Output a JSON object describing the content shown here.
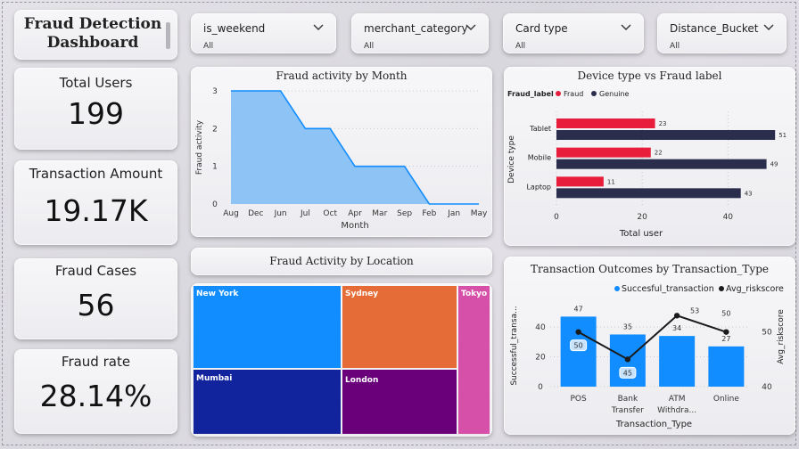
{
  "header": {
    "title_line1": "Fraud Detection",
    "title_line2": "Dashboard"
  },
  "slicers": [
    {
      "label": "is_weekend",
      "value": "All"
    },
    {
      "label": "merchant_category",
      "value": "All"
    },
    {
      "label": "Card type",
      "value": "All"
    },
    {
      "label": "Distance_Bucket",
      "value": "All"
    }
  ],
  "kpis": {
    "total_users": {
      "label": "Total Users",
      "value": "199"
    },
    "transaction_amount": {
      "label": "Transaction Amount",
      "value": "19.17K"
    },
    "fraud_cases": {
      "label": "Fraud Cases",
      "value": "56"
    },
    "fraud_rate": {
      "label": "Fraud rate",
      "value": "28.14%"
    }
  },
  "treemap_title": "Fraud Activity by Location",
  "treemap": {
    "cells": [
      {
        "label": "New York",
        "color": "#118dff"
      },
      {
        "label": "Sydney",
        "color": "#e66c37"
      },
      {
        "label": "Tokyo",
        "color": "#d64fa8"
      },
      {
        "label": "Mumbai",
        "color": "#12239e"
      },
      {
        "label": "London",
        "color": "#6b007b"
      }
    ]
  },
  "chart_data": [
    {
      "type": "area",
      "title": "Fraud activity by Month",
      "xlabel": "Month",
      "ylabel": "Fraud activity",
      "categories": [
        "Aug",
        "Dec",
        "Jun",
        "Jul",
        "Oct",
        "Apr",
        "Mar",
        "Sep",
        "Feb",
        "Jan",
        "May"
      ],
      "values": [
        3,
        3,
        3,
        2,
        2,
        1,
        1,
        1,
        0,
        0,
        0
      ],
      "ylim": [
        0,
        3
      ],
      "yticks": [
        "0",
        "1",
        "2",
        "3"
      ],
      "color": "#118dff"
    },
    {
      "type": "bar",
      "orientation": "horizontal",
      "title": "Device type vs Fraud label",
      "legend_title": "Fraud_label",
      "xlabel": "Total user",
      "ylabel": "Device type",
      "categories": [
        "Tablet",
        "Mobile",
        "Laptop"
      ],
      "series": [
        {
          "name": "Fraud",
          "color": "#e81d3c",
          "values": [
            23,
            22,
            11
          ]
        },
        {
          "name": "Genuine",
          "color": "#2b2d4d",
          "values": [
            51,
            49,
            43
          ]
        }
      ],
      "xticks": [
        "0",
        "20",
        "40"
      ],
      "xlim": [
        0,
        52
      ]
    },
    {
      "type": "bar",
      "title": "Transaction Outcomes by Transaction_Type",
      "xlabel": "Transaction_Type",
      "ylabel": "Successful_transa...",
      "y2label": "Avg_riskscore",
      "categories": [
        [
          "POS"
        ],
        [
          "Bank",
          "Transfer"
        ],
        [
          "ATM",
          "Withdra..."
        ],
        [
          "Online"
        ]
      ],
      "series": [
        {
          "name": "Succesful_transaction",
          "color": "#118dff",
          "values": [
            47,
            35,
            34,
            27
          ]
        },
        {
          "name": "Avg_riskscore",
          "type": "line",
          "color": "#1a1a1a",
          "values": [
            50,
            45,
            53,
            50
          ]
        }
      ],
      "yticks": [
        "0",
        "20",
        "40"
      ],
      "ylim": [
        0,
        55
      ],
      "y2ticks": [
        "40",
        "50"
      ],
      "y2lim": [
        40,
        55
      ]
    }
  ]
}
